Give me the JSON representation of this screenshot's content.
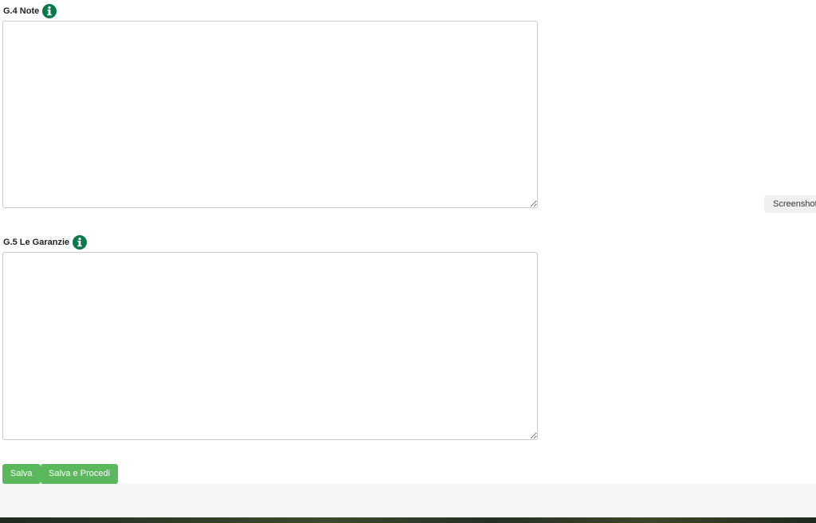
{
  "fields": [
    {
      "label": "G.4 Note",
      "value": ""
    },
    {
      "label": "G.5 Le Garanzie",
      "value": ""
    }
  ],
  "buttons": {
    "save": "Salva",
    "save_proceed": "Salva e Procedi"
  },
  "screenshot_tab": "Screenshot",
  "colors": {
    "info_icon": "#0a7a4a",
    "button_bg": "#5cb85c"
  },
  "icons": {
    "info": "info-circle-icon"
  }
}
